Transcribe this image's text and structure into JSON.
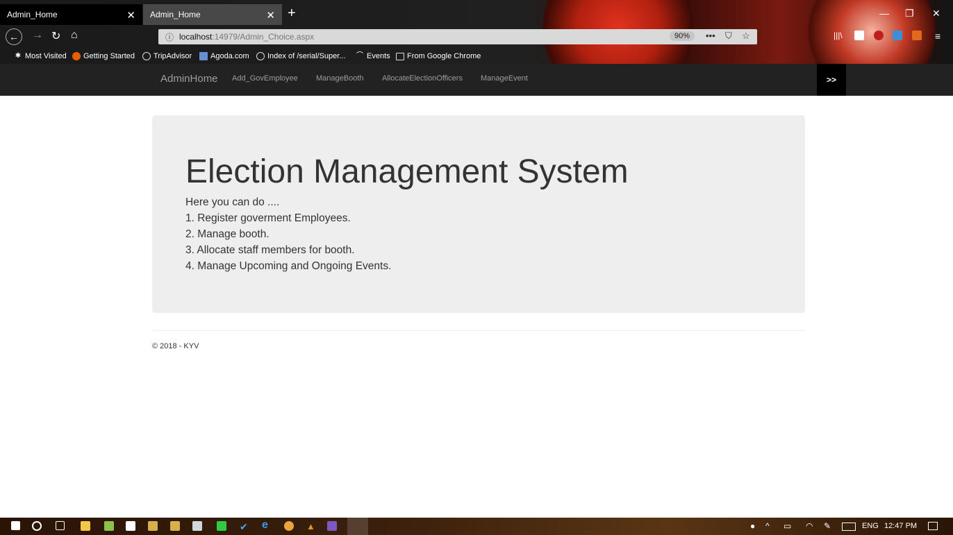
{
  "browser": {
    "tabs": [
      {
        "title": "Admin_Home"
      },
      {
        "title": "Admin_Home"
      }
    ],
    "url": {
      "host": "localhost",
      "path": ":14979/Admin_Choice.aspx"
    },
    "zoom": "90%",
    "bookmarks": [
      "Most Visited",
      "Getting Started",
      "TripAdvisor",
      "Agoda.com",
      "Index of /serial/Super...",
      "Events",
      "From Google Chrome"
    ]
  },
  "site_nav": {
    "brand": "AdminHome",
    "links": [
      "Add_GovEmployee",
      "ManageBooth",
      "AllocateElectionOfficers",
      "ManageEvent"
    ],
    "expand_label": ">>"
  },
  "jumbotron": {
    "title": "Election Management System",
    "lines": [
      "Here you can do ....",
      "1. Register goverment Employees.",
      "2. Manage booth.",
      "3. Allocate staff members for booth.",
      "4. Manage Upcoming and Ongoing Events."
    ]
  },
  "footer": {
    "text": "© 2018 - KYV"
  },
  "taskbar": {
    "lang": "ENG",
    "time": "12:47 PM"
  }
}
